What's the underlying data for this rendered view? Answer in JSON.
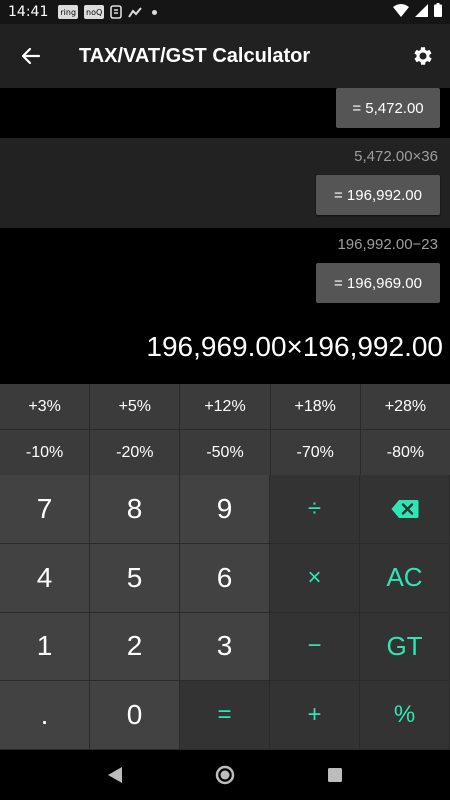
{
  "status": {
    "time": "14:41",
    "icons": [
      "ring",
      "noQ",
      "notification-icon",
      "graph-icon",
      "dot"
    ]
  },
  "appbar": {
    "title": "TAX/VAT/GST Calculator",
    "back_icon": "arrow-left-icon",
    "settings_icon": "gear-icon"
  },
  "history": [
    {
      "expression": "",
      "result": "= 5,472.00"
    },
    {
      "expression": "5,472.00×36",
      "result": "= 196,992.00"
    },
    {
      "expression": "196,992.00−23",
      "result": "= 196,969.00"
    }
  ],
  "display": "196,969.00×196,992.00",
  "percent_keys": {
    "plus": [
      "+3%",
      "+5%",
      "+12%",
      "+18%",
      "+28%"
    ],
    "minus": [
      "-10%",
      "-20%",
      "-50%",
      "-70%",
      "-80%"
    ]
  },
  "keys": {
    "seven": "7",
    "eight": "8",
    "nine": "9",
    "divide": "÷",
    "four": "4",
    "five": "5",
    "six": "6",
    "multiply": "×",
    "all_clear": "AC",
    "one": "1",
    "two": "2",
    "three": "3",
    "minus": "−",
    "grand_total": "GT",
    "dot": ".",
    "zero": "0",
    "equals": "=",
    "plus": "+",
    "percent": "%"
  },
  "colors": {
    "accent": "#2ee6b4",
    "appbar": "#212121",
    "number_key": "#424242",
    "operator_key": "#333333"
  }
}
